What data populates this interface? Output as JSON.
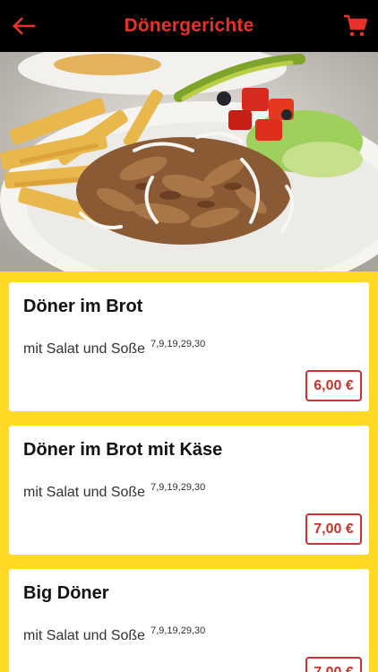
{
  "header": {
    "title": "Dönergerichte",
    "back_icon": "back-arrow-icon",
    "cart_icon": "shopping-cart-icon",
    "accent_color": "#e8312b"
  },
  "hero": {
    "image": "döner plate with fries and salad"
  },
  "menu": {
    "items": [
      {
        "name": "Döner im Brot",
        "description": "mit Salat und Soße",
        "codes": "7,9,19,29,30",
        "price": "6,00 €"
      },
      {
        "name": "Döner im Brot mit Käse",
        "description": "mit Salat und Soße",
        "codes": "7,9,19,29,30",
        "price": "7,00 €"
      },
      {
        "name": "Big Döner",
        "description": "mit Salat und Soße",
        "codes": "7,9,19,29,30",
        "price": "7,00 €"
      }
    ]
  },
  "colors": {
    "background": "#ffd923",
    "topbar": "#000000",
    "price_border": "#c9332b"
  }
}
